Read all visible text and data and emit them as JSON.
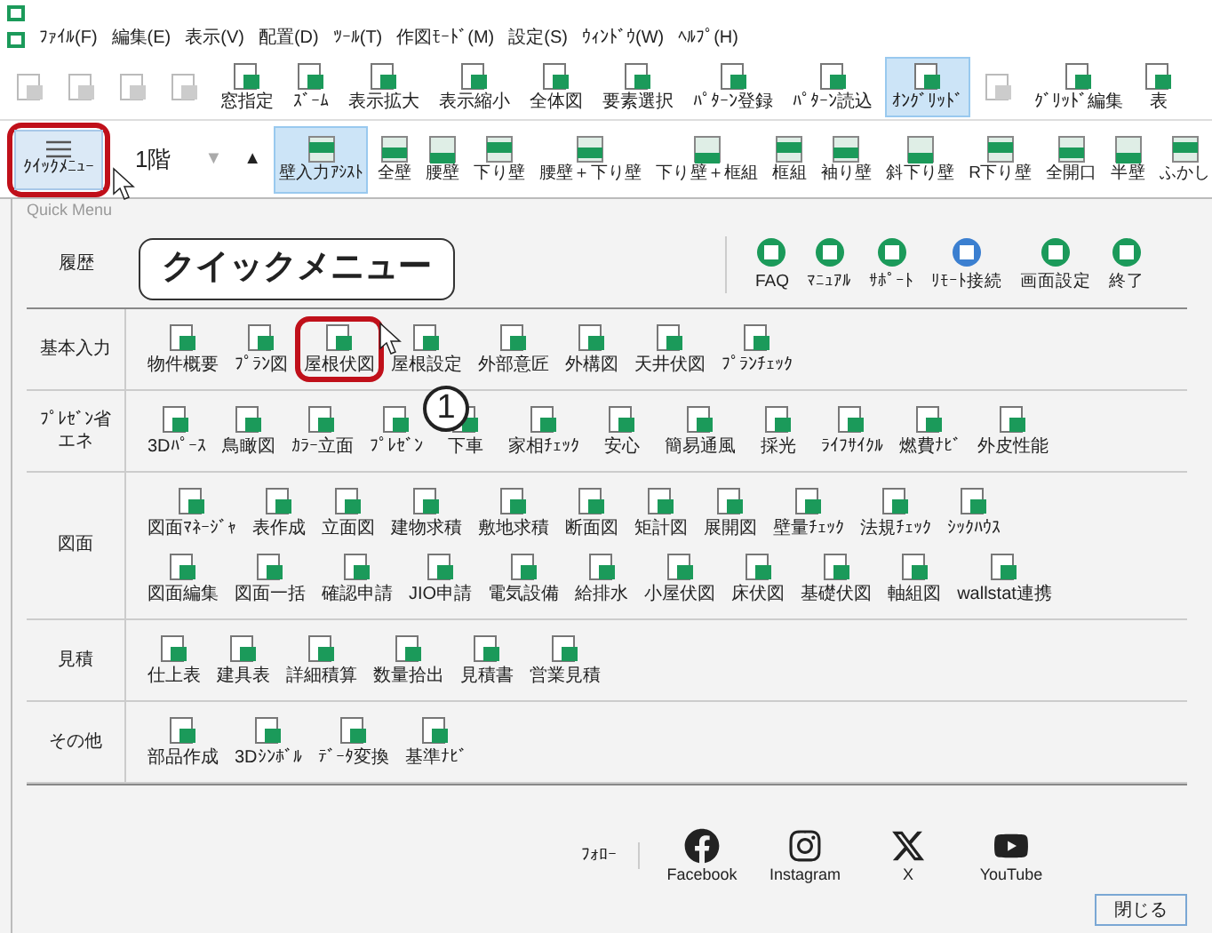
{
  "menu": [
    "ﾌｧｲﾙ(F)",
    "編集(E)",
    "表示(V)",
    "配置(D)",
    "ﾂｰﾙ(T)",
    "作図ﾓｰﾄﾞ(M)",
    "設定(S)",
    "ｳｨﾝﾄﾞｳ(W)",
    "ﾍﾙﾌﾟ(H)"
  ],
  "toolbar": [
    {
      "disabled": true,
      "selected": false
    },
    {
      "disabled": true,
      "selected": false
    },
    {
      "disabled": true,
      "selected": false
    },
    {
      "disabled": true,
      "selected": false
    },
    {
      "label": "窓指定",
      "disabled": false,
      "selected": false
    },
    {
      "label": "ｽﾞｰﾑ",
      "disabled": false,
      "selected": false
    },
    {
      "label": "表示拡大",
      "disabled": false,
      "selected": false
    },
    {
      "label": "表示縮小",
      "disabled": false,
      "selected": false
    },
    {
      "label": "全体図",
      "disabled": false,
      "selected": false
    },
    {
      "label": "要素選択",
      "disabled": false,
      "selected": false
    },
    {
      "label": "ﾊﾟﾀｰﾝ登録",
      "disabled": false,
      "selected": false
    },
    {
      "label": "ﾊﾟﾀｰﾝ読込",
      "disabled": false,
      "selected": false
    },
    {
      "label": "ｵﾝｸﾞﾘｯﾄﾞ",
      "disabled": false,
      "selected": true
    },
    {
      "disabled": true,
      "selected": false
    },
    {
      "label": "ｸﾞﾘｯﾄﾞ編集",
      "disabled": false,
      "selected": false
    },
    {
      "label": "表",
      "disabled": false,
      "selected": false
    }
  ],
  "quick_menu_button": {
    "label": "ｸｲｯｸﾒﾆｭｰ",
    "highlighted": true
  },
  "floor": "1階",
  "floor_buttons": [
    "▼",
    "▲"
  ],
  "wall_tools": [
    {
      "label": "壁入力ｱｼｽﾄ",
      "selected": true
    },
    {
      "label": "全壁",
      "selected": false
    },
    {
      "label": "腰壁",
      "selected": false
    },
    {
      "label": "下り壁",
      "selected": false
    },
    {
      "label": "腰壁＋下り壁",
      "selected": false
    },
    {
      "label": "下り壁＋框組",
      "selected": false
    },
    {
      "label": "框組",
      "selected": false
    },
    {
      "label": "袖り壁",
      "selected": false
    },
    {
      "label": "斜下り壁",
      "selected": false
    },
    {
      "label": "R下り壁",
      "selected": false
    },
    {
      "label": "全開口",
      "selected": false
    },
    {
      "label": "半壁",
      "selected": false
    },
    {
      "label": "ふかし",
      "selected": false
    }
  ],
  "panel_title": "Quick Menu",
  "history": {
    "label": "履歴",
    "items": [
      "FAQ",
      "ﾏﾆｭｱﾙ",
      "ｻﾎﾟｰﾄ",
      "ﾘﾓｰﾄ接続",
      "画面設定",
      "終了"
    ]
  },
  "sections": [
    {
      "label": "基本入力",
      "rows": [
        [
          {
            "label": "物件概要",
            "highlighted": false
          },
          {
            "label": "ﾌﾟﾗﾝ図",
            "highlighted": false
          },
          {
            "label": "屋根伏図",
            "highlighted": true
          },
          {
            "label": "屋根設定",
            "highlighted": false
          },
          {
            "label": "外部意匠",
            "highlighted": false
          },
          {
            "label": "外構図",
            "highlighted": false
          },
          {
            "label": "天井伏図",
            "highlighted": false
          },
          {
            "label": "ﾌﾟﾗﾝﾁｪｯｸ",
            "highlighted": false
          }
        ]
      ]
    },
    {
      "label": "ﾌﾟﾚｾﾞﾝ省エネ",
      "rows": [
        [
          {
            "label": "3Dﾊﾟｰｽ",
            "highlighted": false
          },
          {
            "label": "鳥瞰図",
            "highlighted": false
          },
          {
            "label": "ｶﾗｰ立面",
            "highlighted": false
          },
          {
            "label": "ﾌﾟﾚｾﾞﾝ",
            "highlighted": false
          },
          {
            "label": "下車",
            "highlighted": false
          },
          {
            "label": "家相ﾁｪｯｸ",
            "highlighted": false
          },
          {
            "label": "安心",
            "highlighted": false
          },
          {
            "label": "簡易通風",
            "highlighted": false
          },
          {
            "label": "採光",
            "highlighted": false
          },
          {
            "label": "ﾗｲﾌｻｲｸﾙ",
            "highlighted": false
          },
          {
            "label": "燃費ﾅﾋﾞ",
            "highlighted": false
          },
          {
            "label": "外皮性能",
            "highlighted": false
          }
        ]
      ]
    },
    {
      "label": "図面",
      "rows": [
        [
          {
            "label": "図面ﾏﾈｰｼﾞｬ",
            "highlighted": false
          },
          {
            "label": "表作成",
            "highlighted": false
          },
          {
            "label": "立面図",
            "highlighted": false
          },
          {
            "label": "建物求積",
            "highlighted": false
          },
          {
            "label": "敷地求積",
            "highlighted": false
          },
          {
            "label": "断面図",
            "highlighted": false
          },
          {
            "label": "矩計図",
            "highlighted": false
          },
          {
            "label": "展開図",
            "highlighted": false
          },
          {
            "label": "壁量ﾁｪｯｸ",
            "highlighted": false
          },
          {
            "label": "法規ﾁｪｯｸ",
            "highlighted": false
          },
          {
            "label": "ｼｯｸﾊｳｽ",
            "highlighted": false
          }
        ],
        [
          {
            "label": "図面編集",
            "highlighted": false
          },
          {
            "label": "図面一括",
            "highlighted": false
          },
          {
            "label": "確認申請",
            "highlighted": false
          },
          {
            "label": "JIO申請",
            "highlighted": false
          },
          {
            "label": "電気設備",
            "highlighted": false
          },
          {
            "label": "給排水",
            "highlighted": false
          },
          {
            "label": "小屋伏図",
            "highlighted": false
          },
          {
            "label": "床伏図",
            "highlighted": false
          },
          {
            "label": "基礎伏図",
            "highlighted": false
          },
          {
            "label": "軸組図",
            "highlighted": false
          },
          {
            "label": "wallstat連携",
            "highlighted": false
          }
        ]
      ]
    },
    {
      "label": "見積",
      "rows": [
        [
          {
            "label": "仕上表",
            "highlighted": false
          },
          {
            "label": "建具表",
            "highlighted": false
          },
          {
            "label": "詳細積算",
            "highlighted": false
          },
          {
            "label": "数量拾出",
            "highlighted": false
          },
          {
            "label": "見積書",
            "highlighted": false
          },
          {
            "label": "営業見積",
            "highlighted": false
          }
        ]
      ]
    },
    {
      "label": "その他",
      "rows": [
        [
          {
            "label": "部品作成",
            "highlighted": false
          },
          {
            "label": "3Dｼﾝﾎﾞﾙ",
            "highlighted": false
          },
          {
            "label": "ﾃﾞｰﾀ変換",
            "highlighted": false
          },
          {
            "label": "基準ﾅﾋﾞ",
            "highlighted": false
          }
        ]
      ]
    }
  ],
  "footer": {
    "follow": "ﾌｫﾛｰ",
    "social": [
      "Facebook",
      "Instagram",
      "X",
      "YouTube"
    ],
    "close_button": "閉じる"
  },
  "annotations": {
    "callout": "クイックメニュー",
    "step": "1"
  }
}
